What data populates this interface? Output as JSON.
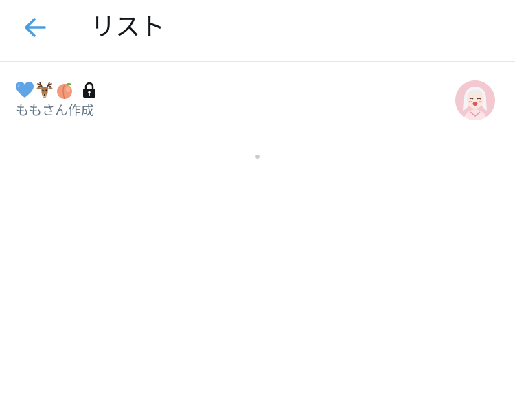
{
  "header": {
    "back_icon": "arrow-left-icon",
    "title": "リスト",
    "accent_color": "#4a9de0"
  },
  "lists": [
    {
      "name_emojis": [
        "blue-heart-icon",
        "deer-icon",
        "peach-icon"
      ],
      "private": true,
      "lock_icon": "lock-icon",
      "owner_label": "ももさん作成",
      "avatar_icon": "avatar"
    }
  ],
  "loading_indicator": "loading-dot"
}
